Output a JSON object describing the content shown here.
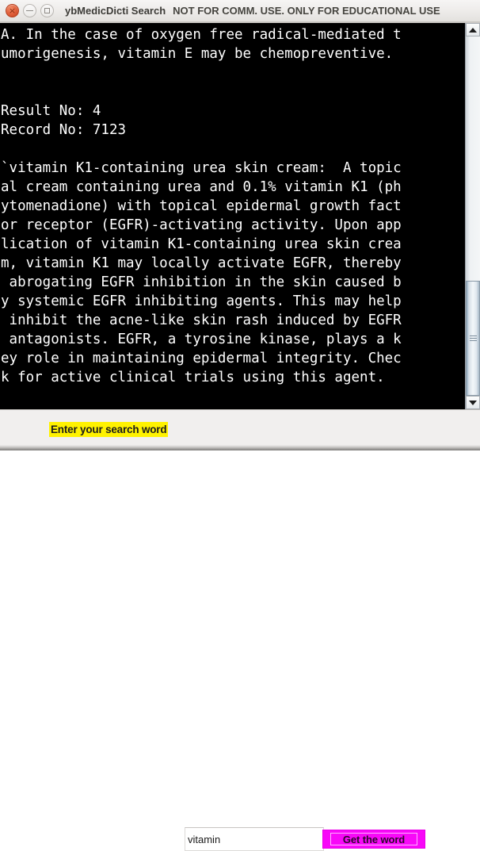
{
  "window": {
    "title_app": "ybMedicDicti Search",
    "title_notice": "NOT FOR COMM. USE.  ONLY FOR EDUCATIONAL USE",
    "controls": {
      "close_label": "×",
      "minimize_name": "minimize",
      "maximize_name": "maximize"
    }
  },
  "result": {
    "text": "A. In the case of oxygen free radical-mediated t\numorigenesis, vitamin E may be chemopreventive.\n\n\nResult No: 4\nRecord No: 7123\n\n`vitamin K1-containing urea skin cream:  A topic\nal cream containing urea and 0.1% vitamin K1 (ph\nytomenadione) with topical epidermal growth fact\nor receptor (EGFR)-activating activity. Upon app\nlication of vitamin K1-containing urea skin crea\nm, vitamin K1 may locally activate EGFR, thereby\n abrogating EGFR inhibition in the skin caused b\ny systemic EGFR inhibiting agents. This may help\n inhibit the acne-like skin rash induced by EGFR\n antagonists. EGFR, a tyrosine kinase, plays a k\ney role in maintaining epidermal integrity. Chec\nk for active clinical trials using this agent.",
    "result_no_label": "Result No:",
    "result_no_value": "4",
    "record_no_label": "Record No:",
    "record_no_value": "7123",
    "background_color": "#000000",
    "text_color": "#ffffff"
  },
  "scrollbar": {
    "up_arrow": "▲",
    "down_arrow": "▼"
  },
  "search": {
    "label": "Enter your search word",
    "label_bg_color": "#fff200",
    "input_value": "vitamin",
    "input_placeholder": "",
    "button_label": "Get the word",
    "button_bg_color": "#f808f8"
  }
}
